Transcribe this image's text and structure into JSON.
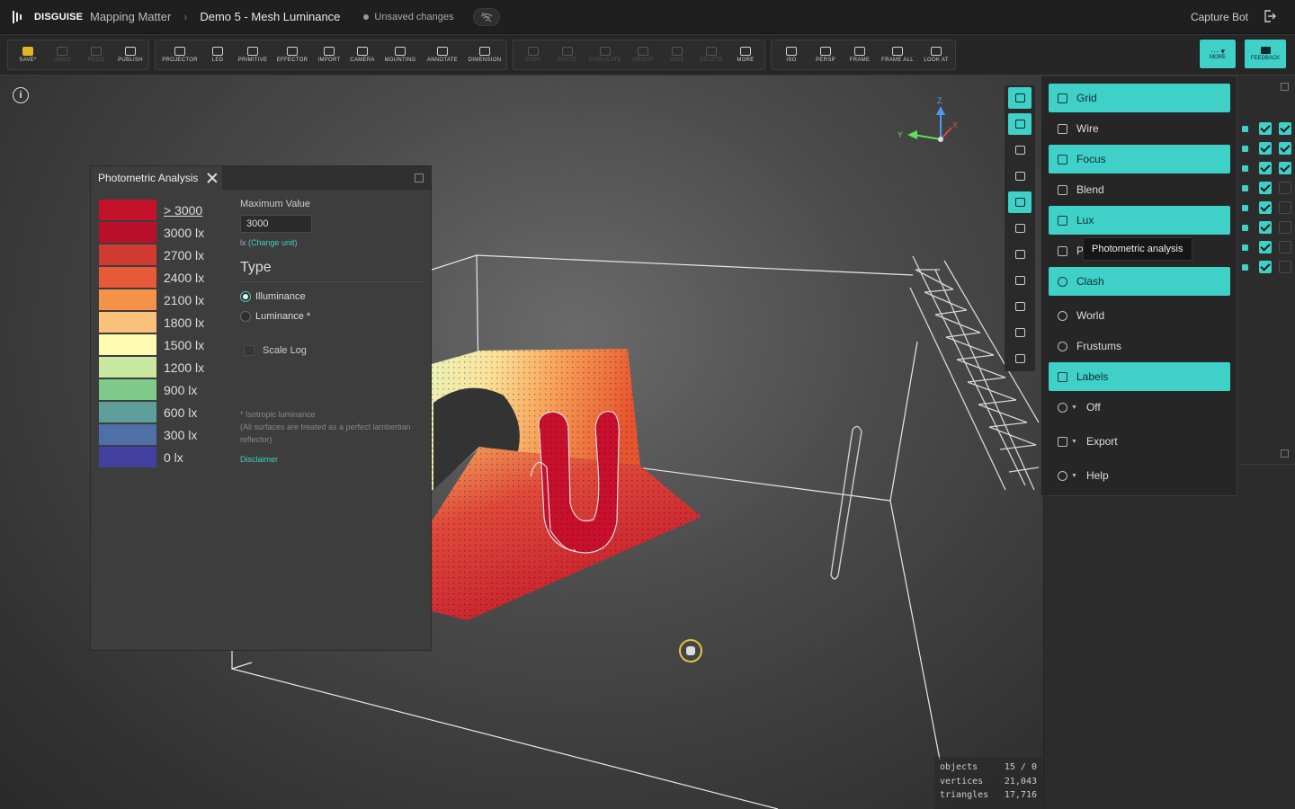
{
  "app": {
    "brand": "DISGUISE",
    "breadcrumb": [
      "Mapping Matter",
      "Demo 5 - Mesh Luminance"
    ],
    "status": "Unsaved changes",
    "user": "Capture Bot"
  },
  "toolbar": {
    "edit": [
      "SAVE*",
      "UNDO",
      "REDO",
      "PUBLISH"
    ],
    "create": [
      "PROJECTOR",
      "LED",
      "PRIMITIVE",
      "EFFECTOR",
      "IMPORT",
      "CAMERA",
      "MOUNTING",
      "ANNOTATE",
      "DIMENSION"
    ],
    "clipboard": [
      "COPY",
      "PASTE",
      "DUPLICATE",
      "GROUP",
      "HIDE",
      "DELETE",
      "MORE"
    ],
    "view": [
      "ISO",
      "PERSP",
      "FRAME",
      "FRAME ALL",
      "LOOK AT"
    ],
    "more_label": "MORE",
    "feedback_label": "FEEDBACK"
  },
  "gizmo": {
    "z": "Z",
    "y": "Y",
    "x": "X"
  },
  "stats": {
    "rows": [
      {
        "label": "objects",
        "value": "15 / 0"
      },
      {
        "label": "vertices",
        "value": "21,043"
      },
      {
        "label": "triangles",
        "value": "17,716"
      }
    ]
  },
  "photometric": {
    "tab_title": "Photometric Analysis",
    "legend": [
      {
        "label": "> 3000",
        "color": "#c4122a"
      },
      {
        "label": "3000 lx",
        "color": "#b8102a"
      },
      {
        "label": "2700 lx",
        "color": "#cf3b30"
      },
      {
        "label": "2400 lx",
        "color": "#e65a39"
      },
      {
        "label": "2100 lx",
        "color": "#f5924a"
      },
      {
        "label": "1800 lx",
        "color": "#fbc07a"
      },
      {
        "label": "1500 lx",
        "color": "#fefbb0"
      },
      {
        "label": "1200 lx",
        "color": "#c8e7a0"
      },
      {
        "label": "900 lx",
        "color": "#7fc98a"
      },
      {
        "label": "600 lx",
        "color": "#5f9f9b"
      },
      {
        "label": "300 lx",
        "color": "#4e6fa8"
      },
      {
        "label": "0 lx",
        "color": "#423f9e"
      }
    ],
    "max_value_label": "Maximum Value",
    "max_value": "3000",
    "unit": "lx",
    "change_unit": "(Change unit)",
    "type_heading": "Type",
    "types": [
      "Illuminance",
      "Luminance *"
    ],
    "selected_type": "Illuminance",
    "scale_log_label": "Scale Log",
    "note_lines": [
      "* Isotropic luminance",
      "(All surfaces are treated as a perfect lambertian reflector)"
    ],
    "disclaimer": "Disclaimer"
  },
  "menu": {
    "items": [
      {
        "label": "Grid",
        "active": true,
        "icon": "grid-icon"
      },
      {
        "label": "Wire",
        "active": false,
        "icon": "wire-icon"
      },
      {
        "label": "Focus",
        "active": true,
        "icon": "focus-icon"
      },
      {
        "label": "Blend",
        "active": false,
        "icon": "blend-icon"
      },
      {
        "label": "Lux",
        "active": true,
        "icon": "lux-icon"
      },
      {
        "label": "P",
        "active": false,
        "icon": "photometric-icon"
      },
      {
        "label": "Clash",
        "active": true,
        "icon": "clash-icon"
      },
      {
        "label": "World",
        "active": false,
        "icon": "world-icon"
      },
      {
        "label": "Frustums",
        "active": false,
        "icon": "frustums-icon"
      },
      {
        "label": "Labels",
        "active": true,
        "icon": "labels-icon"
      },
      {
        "label": "Off",
        "active": false,
        "icon": "off-icon"
      },
      {
        "label": "Export",
        "active": false,
        "icon": "export-icon"
      },
      {
        "label": "Help",
        "active": false,
        "icon": "help-icon"
      }
    ],
    "tooltip": "Photometric analysis"
  },
  "right_panel": {
    "rows": [
      {
        "a": true,
        "b": true
      },
      {
        "a": true,
        "b": true
      },
      {
        "a": true,
        "b": true
      },
      {
        "a": true,
        "b": false
      },
      {
        "a": true,
        "b": false
      },
      {
        "a": true,
        "b": false
      },
      {
        "a": true,
        "b": false
      },
      {
        "a": true,
        "b": false
      }
    ]
  },
  "colors": {
    "accent": "#3fd0c8",
    "save": "#e1b526",
    "cursor": "#e3c53e"
  }
}
